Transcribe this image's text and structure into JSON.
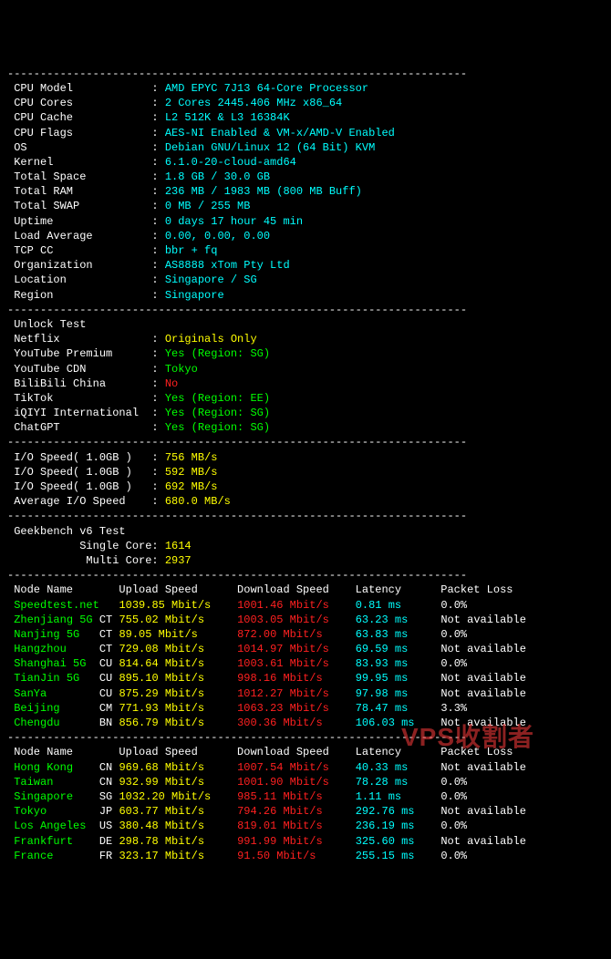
{
  "sysinfo": [
    {
      "label": "CPU Model",
      "value": "AMD EPYC 7J13 64-Core Processor"
    },
    {
      "label": "CPU Cores",
      "value": "2 Cores 2445.406 MHz x86_64"
    },
    {
      "label": "CPU Cache",
      "value": "L2 512K & L3 16384K"
    },
    {
      "label": "CPU Flags",
      "value": "AES-NI Enabled & VM-x/AMD-V Enabled"
    },
    {
      "label": "OS",
      "value": "Debian GNU/Linux 12 (64 Bit) KVM"
    },
    {
      "label": "Kernel",
      "value": "6.1.0-20-cloud-amd64"
    },
    {
      "label": "Total Space",
      "value": "1.8 GB / 30.0 GB"
    },
    {
      "label": "Total RAM",
      "value": "236 MB / 1983 MB (800 MB Buff)"
    },
    {
      "label": "Total SWAP",
      "value": "0 MB / 255 MB"
    },
    {
      "label": "Uptime",
      "value": "0 days 17 hour 45 min"
    },
    {
      "label": "Load Average",
      "value": "0.00, 0.00, 0.00"
    },
    {
      "label": "TCP CC",
      "value": "bbr + fq"
    },
    {
      "label": "Organization",
      "value": "AS8888 xTom Pty Ltd"
    },
    {
      "label": "Location",
      "value": "Singapore / SG"
    },
    {
      "label": "Region",
      "value": "Singapore"
    }
  ],
  "unlock_header": "Unlock Test",
  "unlock": [
    {
      "name": "Netflix",
      "value": "Originals Only",
      "color": "yellow"
    },
    {
      "name": "YouTube Premium",
      "value": "Yes (Region: SG)",
      "color": "green"
    },
    {
      "name": "YouTube CDN",
      "value": "Tokyo",
      "color": "green"
    },
    {
      "name": "BiliBili China",
      "value": "No",
      "color": "red"
    },
    {
      "name": "TikTok",
      "value": "Yes (Region: EE)",
      "color": "green"
    },
    {
      "name": "iQIYI International",
      "value": "Yes (Region: SG)",
      "color": "green"
    },
    {
      "name": "ChatGPT",
      "value": "Yes (Region: SG)",
      "color": "green"
    }
  ],
  "io_header": "I/O Speed( 1.0GB )",
  "io": [
    "756 MB/s",
    "592 MB/s",
    "692 MB/s"
  ],
  "io_avg_label": "Average I/O Speed",
  "io_avg": "680.0 MB/s",
  "geekbench_header": "Geekbench v6 Test",
  "single_core_label": "Single Core",
  "single_core": "1614",
  "multi_core_label": "Multi Core",
  "multi_core": "2937",
  "speed_header": {
    "c1": "Node Name",
    "c2": "Upload Speed",
    "c3": "Download Speed",
    "c4": "Latency",
    "c5": "Packet Loss"
  },
  "speed1": [
    {
      "name": "Speedtest.net",
      "cc": "",
      "up": "1039.85 Mbit/s",
      "dn": "1001.46 Mbit/s",
      "lat": "0.81 ms",
      "pl": "0.0%"
    },
    {
      "name": "Zhenjiang 5G",
      "cc": "CT",
      "up": "755.02 Mbit/s",
      "dn": "1003.05 Mbit/s",
      "lat": "63.23 ms",
      "pl": "Not available"
    },
    {
      "name": "Nanjing 5G",
      "cc": "CT",
      "up": "89.05 Mbit/s",
      "dn": "872.00 Mbit/s",
      "lat": "63.83 ms",
      "pl": "0.0%"
    },
    {
      "name": "Hangzhou",
      "cc": "CT",
      "up": "729.08 Mbit/s",
      "dn": "1014.97 Mbit/s",
      "lat": "69.59 ms",
      "pl": "Not available"
    },
    {
      "name": "Shanghai 5G",
      "cc": "CU",
      "up": "814.64 Mbit/s",
      "dn": "1003.61 Mbit/s",
      "lat": "83.93 ms",
      "pl": "0.0%"
    },
    {
      "name": "TianJin 5G",
      "cc": "CU",
      "up": "895.10 Mbit/s",
      "dn": "998.16 Mbit/s",
      "lat": "99.95 ms",
      "pl": "Not available"
    },
    {
      "name": "SanYa",
      "cc": "CU",
      "up": "875.29 Mbit/s",
      "dn": "1012.27 Mbit/s",
      "lat": "97.98 ms",
      "pl": "Not available"
    },
    {
      "name": "Beijing",
      "cc": "CM",
      "up": "771.93 Mbit/s",
      "dn": "1063.23 Mbit/s",
      "lat": "78.47 ms",
      "pl": "3.3%"
    },
    {
      "name": "Chengdu",
      "cc": "BN",
      "up": "856.79 Mbit/s",
      "dn": "300.36 Mbit/s",
      "lat": "106.03 ms",
      "pl": "Not available"
    }
  ],
  "speed2": [
    {
      "name": "Hong Kong",
      "cc": "CN",
      "up": "969.68 Mbit/s",
      "dn": "1007.54 Mbit/s",
      "lat": "40.33 ms",
      "pl": "Not available"
    },
    {
      "name": "Taiwan",
      "cc": "CN",
      "up": "932.99 Mbit/s",
      "dn": "1001.90 Mbit/s",
      "lat": "78.28 ms",
      "pl": "0.0%"
    },
    {
      "name": "Singapore",
      "cc": "SG",
      "up": "1032.20 Mbit/s",
      "dn": "985.11 Mbit/s",
      "lat": "1.11 ms",
      "pl": "0.0%"
    },
    {
      "name": "Tokyo",
      "cc": "JP",
      "up": "603.77 Mbit/s",
      "dn": "794.26 Mbit/s",
      "lat": "292.76 ms",
      "pl": "Not available"
    },
    {
      "name": "Los Angeles",
      "cc": "US",
      "up": "380.48 Mbit/s",
      "dn": "819.01 Mbit/s",
      "lat": "236.19 ms",
      "pl": "0.0%"
    },
    {
      "name": "Frankfurt",
      "cc": "DE",
      "up": "298.78 Mbit/s",
      "dn": "991.99 Mbit/s",
      "lat": "325.60 ms",
      "pl": "Not available"
    },
    {
      "name": "France",
      "cc": "FR",
      "up": "323.17 Mbit/s",
      "dn": "91.50 Mbit/s",
      "lat": "255.15 ms",
      "pl": "0.0%"
    }
  ],
  "dash": "----------------------------------------------------------------------",
  "watermark": "VPS收割者"
}
